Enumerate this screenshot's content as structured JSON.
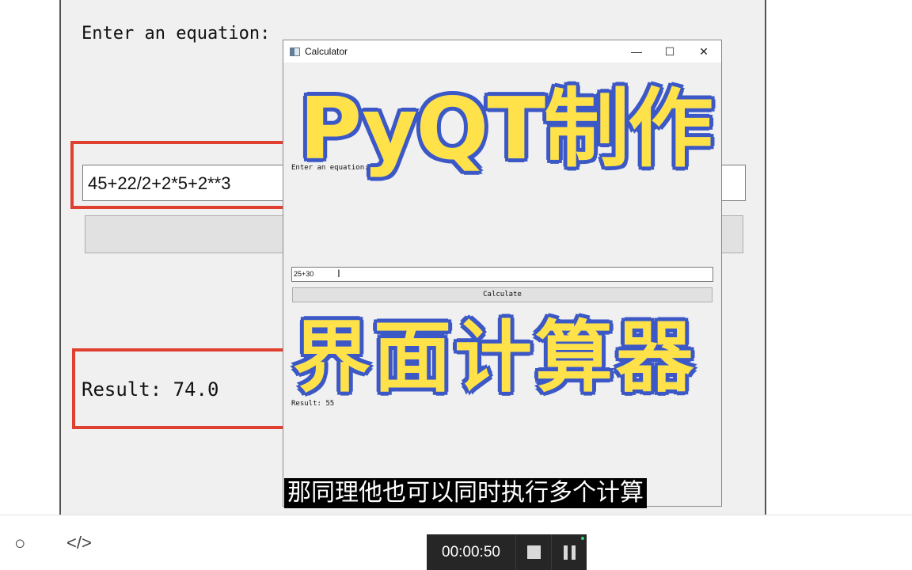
{
  "background_window": {
    "label": "Enter an equation:",
    "input_value": "45+22/2+2*5+2**3",
    "result": "Result: 74.0"
  },
  "window": {
    "title": "Calculator",
    "minimize": "—",
    "maximize": "☐",
    "close": "✕",
    "label": "Enter an equation:",
    "input_value": "25+30",
    "button_label": "Calculate",
    "result": "Result: 55"
  },
  "overlay": {
    "title_line1": "PyQT制作",
    "title_line2": "界面计算器"
  },
  "subtitle": "那同理他也可以同时执行多个计算",
  "recorder": {
    "time": "00:00:50"
  },
  "colors": {
    "highlight_red": "#e0402f",
    "overlay_yellow": "#ffe24a",
    "overlay_blue": "#3b58c6"
  }
}
